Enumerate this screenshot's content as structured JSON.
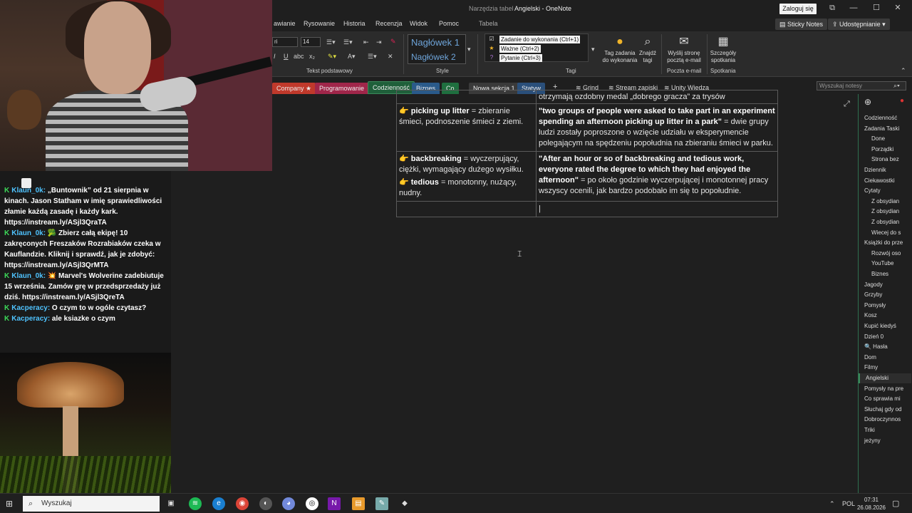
{
  "window": {
    "context_group": "Narzędzia tabel",
    "title": "Angielski - OneNote",
    "signin": "Zaloguj się"
  },
  "ribbon_tabs": {
    "items": [
      "awianie",
      "Rysowanie",
      "Historia",
      "Recenzja",
      "Widok",
      "Pomoc"
    ],
    "context_tab": "Tabela",
    "sticky_notes": "Sticky Notes",
    "share": "Udostępnianie"
  },
  "ribbon": {
    "font_name": "ri",
    "font_size": "14",
    "group_basic_text": "Tekst podstawowy",
    "heading1": "Nagłówek 1",
    "heading2": "Nagłówek 2",
    "group_styles": "Style",
    "tags": [
      {
        "label": "Zadanie do wykonania (Ctrl+1)"
      },
      {
        "label": "Ważne (Ctrl+2)"
      },
      {
        "label": "Pytanie (Ctrl+3)"
      }
    ],
    "group_tags": "Tagi",
    "todo_tag_line1": "Tag zadania",
    "todo_tag_line2": "do wykonania",
    "find_tags_line1": "Znajdź",
    "find_tags_line2": "tagi",
    "email_line1": "Wyślij stronę",
    "email_line2": "pocztą e-mail",
    "group_email": "Poczta e-mail",
    "meeting_line1": "Szczegóły",
    "meeting_line2": "spotkania",
    "group_meetings": "Spotkania"
  },
  "sections": {
    "tabs": [
      {
        "label": "Company ★",
        "color": "#c0392b"
      },
      {
        "label": "Programowanie",
        "color": "#a0264a"
      },
      {
        "label": "Codzienność",
        "color": "#1f5f3a"
      },
      {
        "label": "Biznes",
        "color": "#2a5a8a"
      },
      {
        "label": "Co",
        "color": "#1f6f3f"
      },
      {
        "label": "Nowa sekcja 1",
        "color": "#3a3a3a"
      },
      {
        "label": "Statyw",
        "color": "#2a4f7a"
      }
    ],
    "add": "+",
    "page_links": [
      "Grind",
      "Stream zapiski",
      "Unity Wiedza"
    ],
    "search_placeholder": "Wyszukaj notesy"
  },
  "page": {
    "top_cut_text": "otrzymają ozdobny medal „dobrego gracza” za trysów",
    "rows": [
      {
        "term": "picking up litter",
        "definition": " = zbieranie śmieci, podnoszenie śmieci z ziemi.",
        "example_bold": "\"two groups of people were asked to take part in an experiment spending an afternoon picking up litter in a park\"",
        "example_rest": " = dwie grupy ludzi zostały poproszone o wzięcie udziału w eksperymencie polegającym na spędzeniu popołudnia na zbieraniu śmieci w parku."
      },
      {
        "term": "backbreaking",
        "definition": " = wyczerpujący, ciężki, wymagający dużego wysiłku.",
        "term2": "tedious",
        "definition2": " = monotonny, nużący, nudny.",
        "example_bold": "\"After an hour or so of backbreaking and tedious work, everyone rated the degree to which they had enjoyed the afternoon\"",
        "example_rest": " = po około godzinie wyczerpującej i monotonnej pracy wszyscy ocenili, jak bardzo podobało im się to popołudnie."
      }
    ]
  },
  "pages_list": [
    {
      "label": "Codzienność",
      "indent": 0
    },
    {
      "label": "Zadania Taski",
      "indent": 0
    },
    {
      "label": "Done",
      "indent": 1
    },
    {
      "label": "Porządki",
      "indent": 1
    },
    {
      "label": "Strona bez",
      "indent": 1
    },
    {
      "label": "Dziennik",
      "indent": 0
    },
    {
      "label": "Ciekawostki",
      "indent": 0
    },
    {
      "label": "Cytaty",
      "indent": 0
    },
    {
      "label": "Z obsydian",
      "indent": 1
    },
    {
      "label": "Z obsydian",
      "indent": 1
    },
    {
      "label": "Z obsydian",
      "indent": 1
    },
    {
      "label": "Wiecej do s",
      "indent": 1
    },
    {
      "label": "Książki do prze",
      "indent": 0
    },
    {
      "label": "Rozwój oso",
      "indent": 1
    },
    {
      "label": "YouTube",
      "indent": 1
    },
    {
      "label": "Biznes",
      "indent": 1
    },
    {
      "label": "Jagody",
      "indent": 0
    },
    {
      "label": "Grzyby",
      "indent": 0
    },
    {
      "label": "Pomysły",
      "indent": 0
    },
    {
      "label": "Kosz",
      "indent": 0
    },
    {
      "label": "Kupić kiedyś",
      "indent": 0
    },
    {
      "label": "Dzień 0",
      "indent": 0
    },
    {
      "label": "🔍 Hasła",
      "indent": 0
    },
    {
      "label": "Dom",
      "indent": 0
    },
    {
      "label": "Filmy",
      "indent": 0
    },
    {
      "label": "Angielski",
      "indent": 0,
      "selected": true
    },
    {
      "label": "Pomysły na pre",
      "indent": 0
    },
    {
      "label": "Co sprawia mi",
      "indent": 0
    },
    {
      "label": "Słuchaj gdy od",
      "indent": 0
    },
    {
      "label": "Dobroczynnos",
      "indent": 0
    },
    {
      "label": "Triki",
      "indent": 0
    },
    {
      "label": "jeżyny",
      "indent": 0
    }
  ],
  "chat": {
    "messages": [
      {
        "user": "Klaun_0k:",
        "text": " „Buntownik” od 21 sierpnia w kinach. Jason Statham w imię sprawiedliwości złamie każdą zasadę i każdy kark. https://instream.ly/ASjl3QraTA"
      },
      {
        "user": "Klaun_0k:",
        "text": " 🥦 Zbierz całą ekipę! 10 zakręconych Freszaków Rozrabiaków czeka w Kauflandzie. Kliknij i sprawdź, jak je zdobyć: https://instream.ly/ASjl3QrMTA"
      },
      {
        "user": "Klaun_0k:",
        "text": " 💥 Marvel's Wolverine zadebiutuje 15 września. Zamów grę w przedsprzedaży już dziś. https://instream.ly/ASjl3QreTA"
      },
      {
        "user": "Kacperacy:",
        "text": " O czym to w ogóle czytasz?"
      },
      {
        "user": "Kacperacy:",
        "text": " ale ksiazke o czym"
      }
    ]
  },
  "taskbar": {
    "search_placeholder": "Wyszukaj",
    "lang": "POL",
    "time": "07:31",
    "date": "26.08.2026"
  }
}
